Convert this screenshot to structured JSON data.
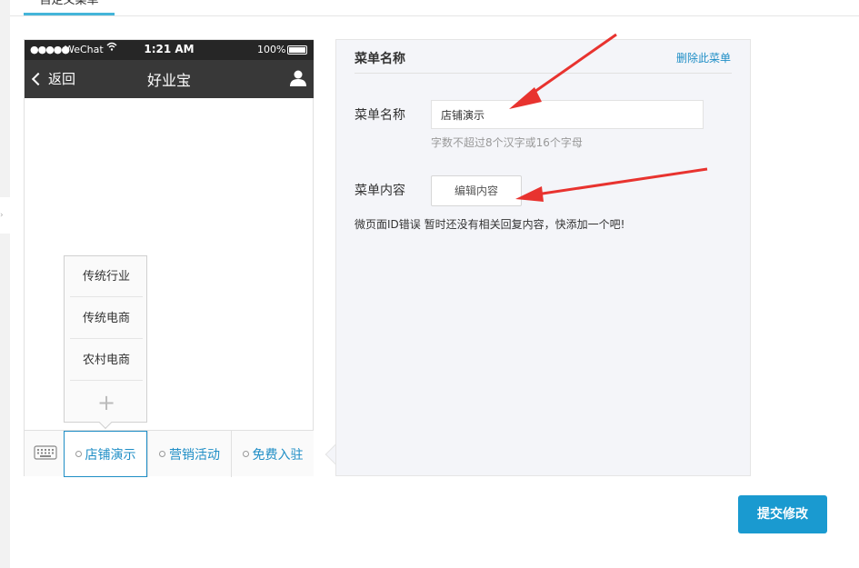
{
  "page": {
    "tab_label": "自定义菜单"
  },
  "phone": {
    "status": {
      "signal": "●●●●●",
      "carrier": "WeChat",
      "time": "1:21 AM",
      "battery": "100%"
    },
    "nav": {
      "back_label": "返回",
      "title": "好业宝"
    },
    "submenu": {
      "items": [
        "传统行业",
        "传统电商",
        "农村电商"
      ],
      "add_symbol": "+"
    },
    "menu": {
      "items": [
        {
          "label": "店铺演示",
          "active": true
        },
        {
          "label": "营销活动",
          "active": false
        },
        {
          "label": "免费入驻",
          "active": false
        }
      ]
    }
  },
  "editor": {
    "header_title": "菜单名称",
    "delete_label": "删除此菜单",
    "name_label": "菜单名称",
    "name_value": "店铺演示",
    "name_hint": "字数不超过8个汉字或16个字母",
    "content_label": "菜单内容",
    "edit_content_button": "编辑内容",
    "content_note": "微页面ID错误 暂时还没有相关回复内容，快添加一个吧!"
  },
  "actions": {
    "submit_label": "提交修改"
  },
  "colors": {
    "accent": "#1a9ad0",
    "link": "#1f8ec6",
    "nav_bg": "#383838",
    "annotation_arrow": "#e8332f"
  }
}
